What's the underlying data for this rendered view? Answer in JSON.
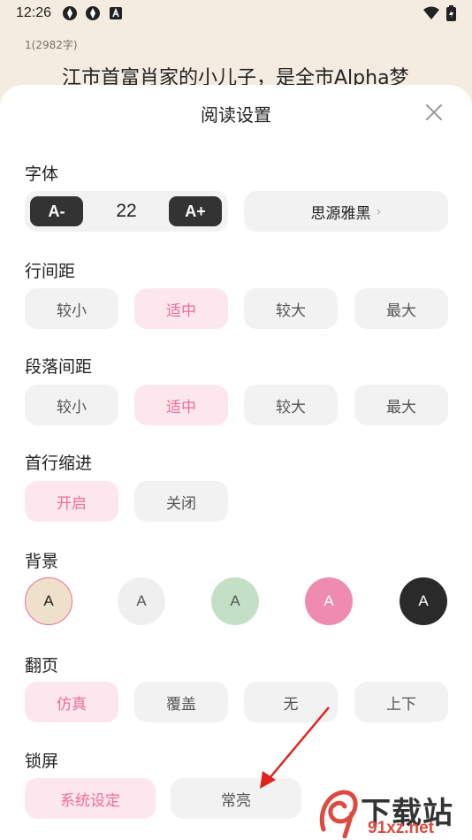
{
  "status_bar": {
    "time": "12:26"
  },
  "reader": {
    "chapter_meta": "1(2982字)",
    "body_text": "江市首富肖家的小儿子，是全市Alpha梦"
  },
  "sheet": {
    "title": "阅读设置",
    "font": {
      "label": "字体",
      "decrease": "A-",
      "size": "22",
      "increase": "A+",
      "family": "思源雅黑"
    },
    "line_spacing": {
      "label": "行间距",
      "options": [
        "较小",
        "适中",
        "较大",
        "最大"
      ],
      "selected": "适中"
    },
    "paragraph_spacing": {
      "label": "段落间距",
      "options": [
        "较小",
        "适中",
        "较大",
        "最大"
      ],
      "selected": "适中"
    },
    "indent": {
      "label": "首行缩进",
      "options": [
        "开启",
        "关闭"
      ],
      "selected": "开启"
    },
    "background": {
      "label": "背景",
      "swatches": [
        {
          "letter": "A",
          "color": "#efe0cb",
          "text_color": "#222222",
          "selected": true
        },
        {
          "letter": "A",
          "color": "#efefef",
          "text_color": "#555555",
          "selected": false
        },
        {
          "letter": "A",
          "color": "#c3dfc6",
          "text_color": "#555555",
          "selected": false
        },
        {
          "letter": "A",
          "color": "#f08bb0",
          "text_color": "#ffffff",
          "selected": false
        },
        {
          "letter": "A",
          "color": "#2a2a2a",
          "text_color": "#ffffff",
          "selected": false
        }
      ]
    },
    "page_turn": {
      "label": "翻页",
      "options": [
        "仿真",
        "覆盖",
        "无",
        "上下"
      ],
      "selected": "仿真"
    },
    "lock_screen": {
      "label": "锁屏",
      "options": [
        "系统设定",
        "常亮"
      ],
      "selected": "系统设定"
    }
  },
  "watermark": {
    "text": "下载站",
    "url": "91xz.net"
  },
  "colors": {
    "accent": "#f06e93",
    "accent_bg": "#fde7ee",
    "option_bg": "#f2f2f2",
    "arrow": "#e0221b"
  }
}
